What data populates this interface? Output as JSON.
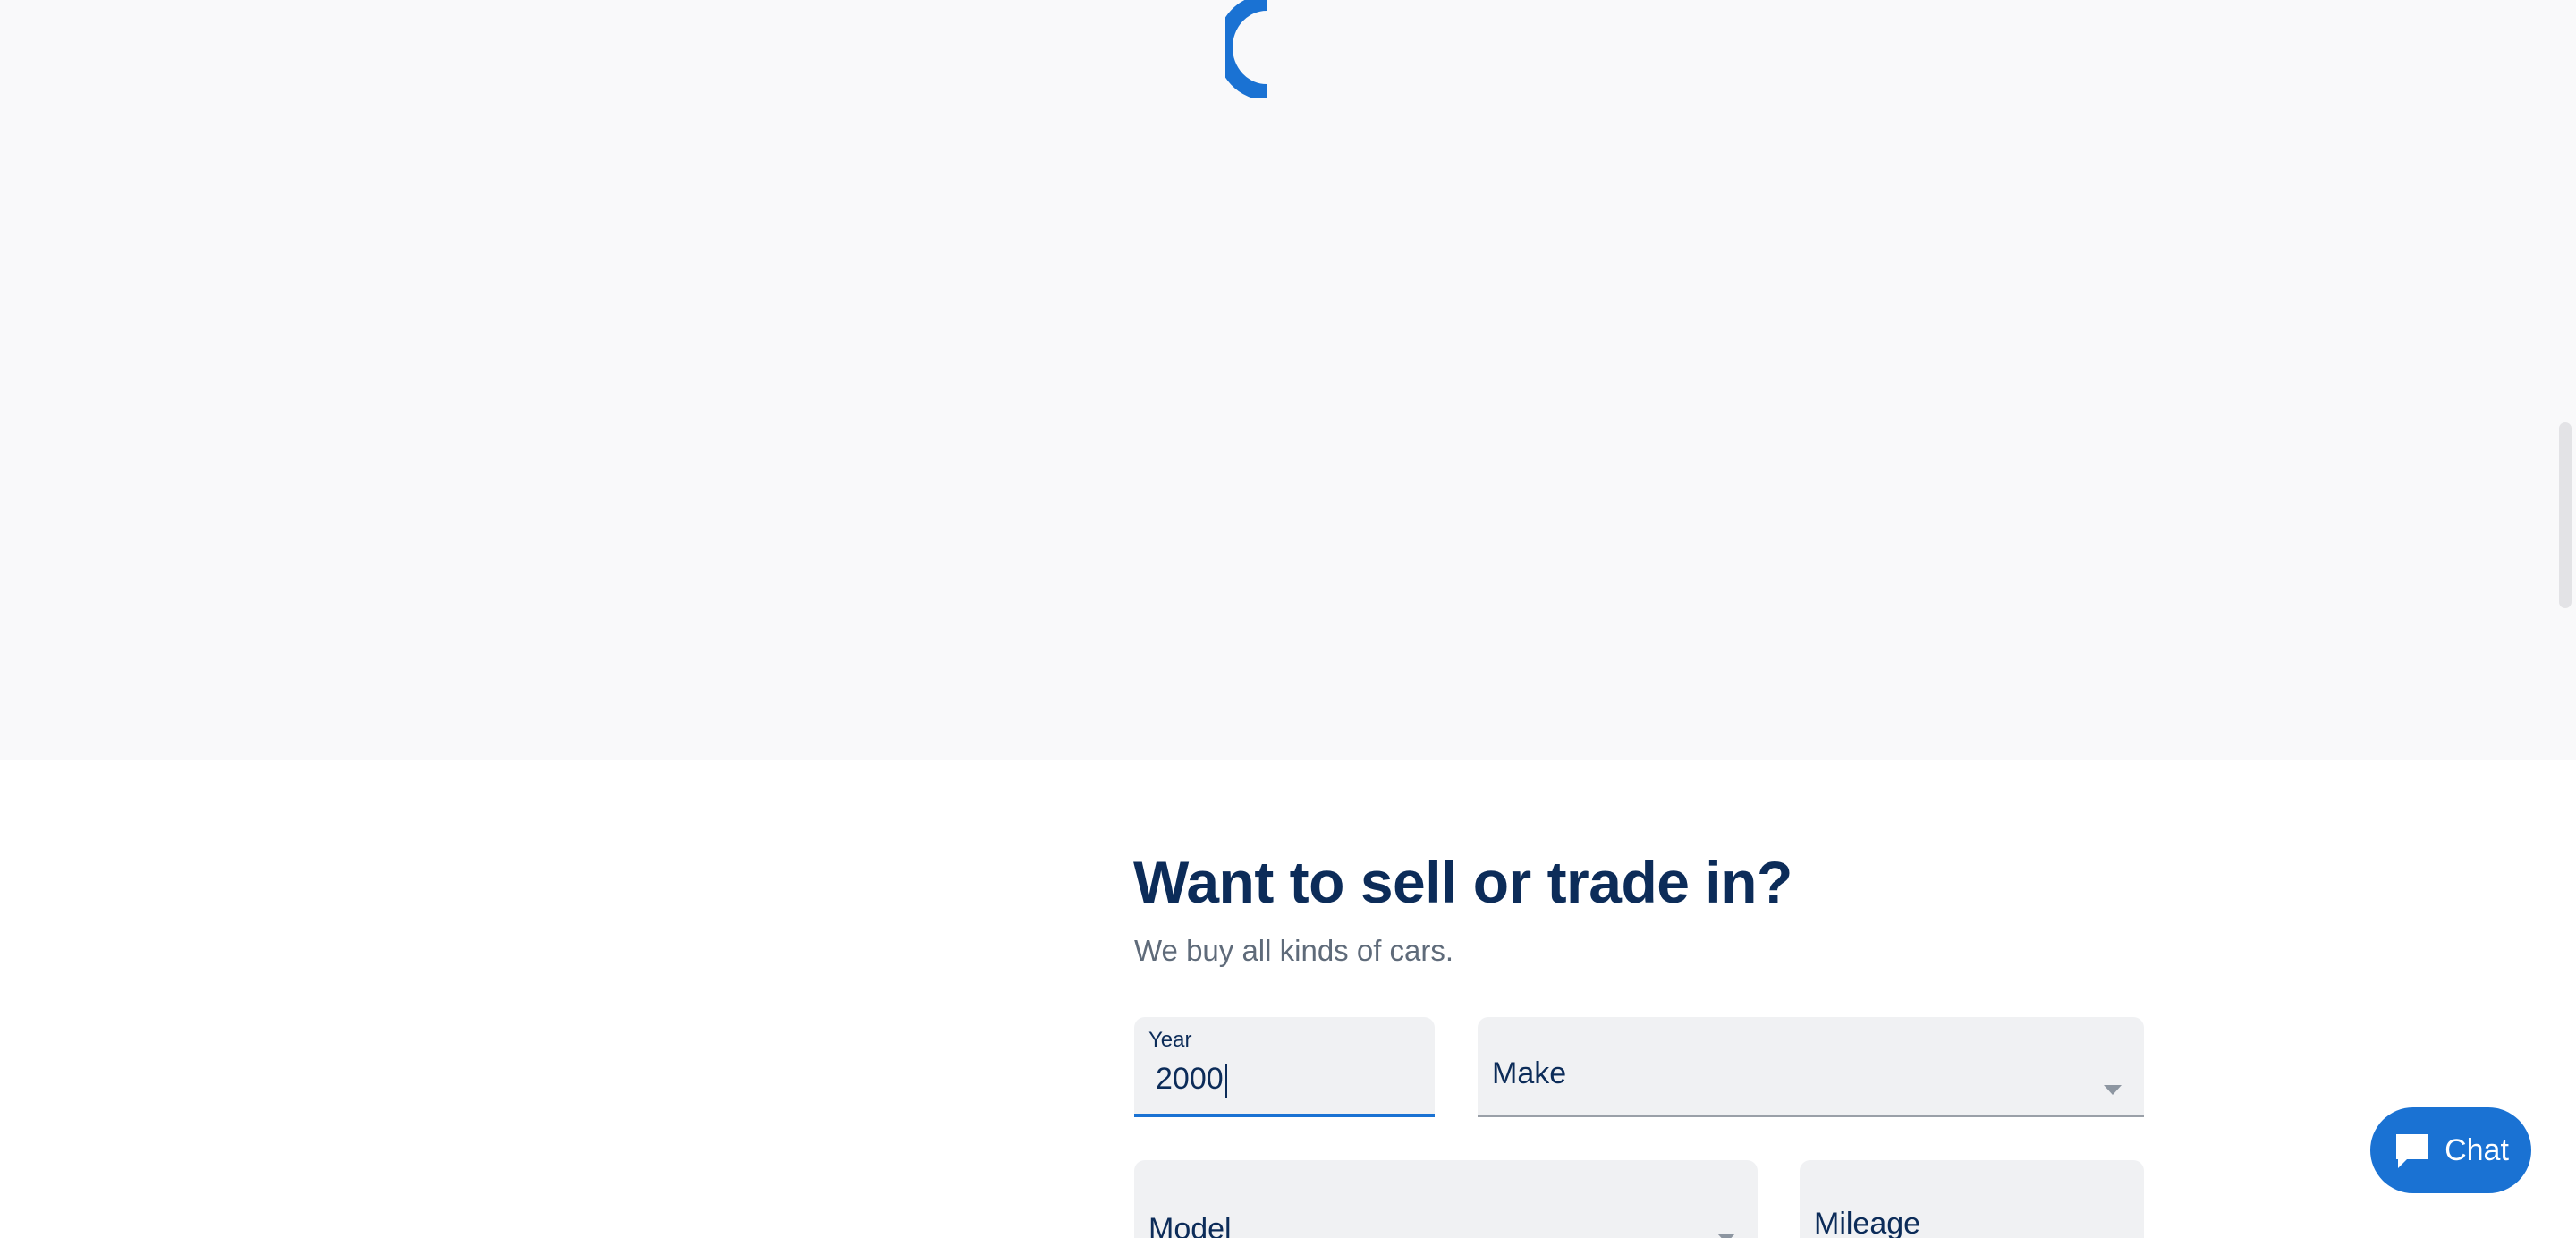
{
  "loading": {
    "icon": "loading-spinner-icon",
    "accent": "#1a72d3"
  },
  "sell": {
    "title": "Want to sell or trade in?",
    "subtitle": "We buy all kinds of cars."
  },
  "form": {
    "year": {
      "label": "Year",
      "value": "2000"
    },
    "make": {
      "placeholder": "Make"
    },
    "model": {
      "placeholder": "Model"
    },
    "mileage": {
      "placeholder": "Mileage"
    }
  },
  "chat": {
    "label": "Chat",
    "icon": "chat-bubble-icon"
  },
  "colors": {
    "primary_navy": "#0c2c59",
    "accent_blue": "#1a72d3",
    "field_bg": "#f0f1f3",
    "loading_bg": "#f9f9fa"
  }
}
